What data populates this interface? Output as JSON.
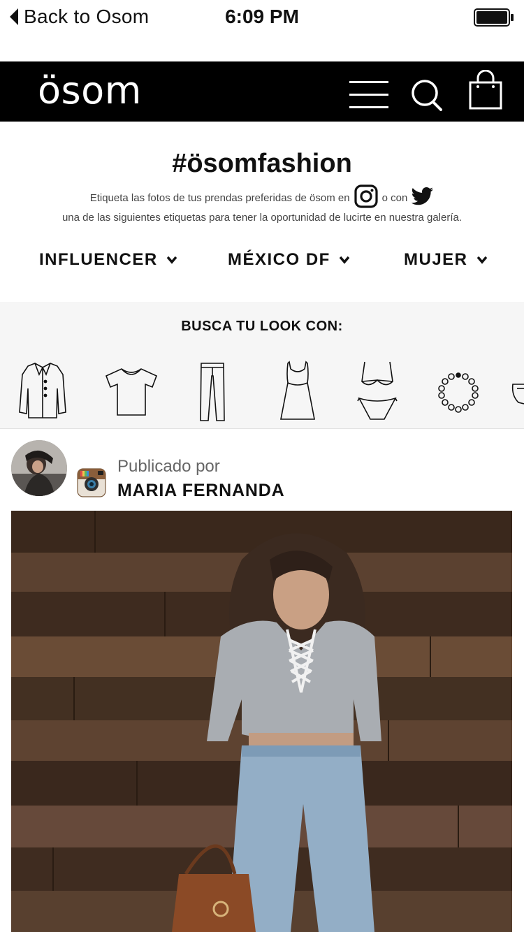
{
  "status_bar": {
    "back_label": "Back to Osom",
    "time": "6:09 PM"
  },
  "header": {
    "logo": "ösom",
    "icons": [
      "menu-icon",
      "search-icon",
      "shopping-bag-icon"
    ]
  },
  "hero": {
    "hashtag": "#ösomfashion",
    "line1_before": "Etiqueta las fotos de tus prendas preferidas de ösom en",
    "line1_middle": "o con",
    "line2": "una de las siguientes etiquetas para tener la oportunidad de lucirte en nuestra galería."
  },
  "filters": [
    {
      "label": "INFLUENCER"
    },
    {
      "label": "MÉXICO DF"
    },
    {
      "label": "MUJER"
    }
  ],
  "look": {
    "title": "BUSCA TU LOOK CON:",
    "garments": [
      "coat-icon",
      "tshirt-icon",
      "pants-icon",
      "dress-icon",
      "swimsuit-icon",
      "necklace-icon",
      "bag-icon"
    ]
  },
  "post": {
    "published_by_label": "Publicado por",
    "author": "MARIA FERNANDA",
    "source_icon": "instagram-icon"
  },
  "colors": {
    "header_bg": "#000000",
    "section_bg": "#f6f6f6",
    "text": "#111111"
  }
}
